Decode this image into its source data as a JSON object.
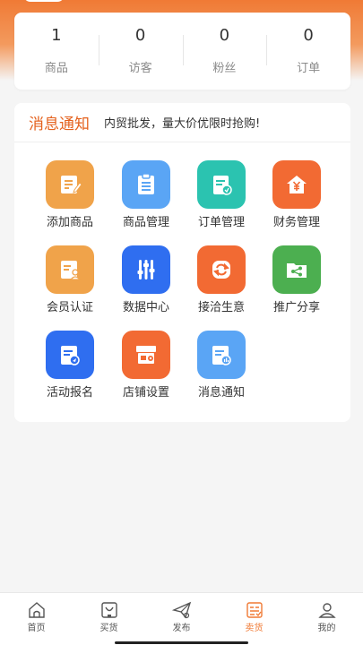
{
  "colors": {
    "accent": "#f07a35",
    "notice_title": "#e4611d",
    "icon_orange": "#f0a34a",
    "icon_blue": "#5aa5f5",
    "icon_teal": "#2bc3b0",
    "icon_red": "#f26a33",
    "icon_royal": "#2f6ef0",
    "icon_green": "#4caf50"
  },
  "stats": [
    {
      "value": "1",
      "label": "商品"
    },
    {
      "value": "0",
      "label": "访客"
    },
    {
      "value": "0",
      "label": "粉丝"
    },
    {
      "value": "0",
      "label": "订单"
    }
  ],
  "notice": {
    "title": "消息通知",
    "text": "内贸批发，量大价优限时抢购!"
  },
  "features": [
    {
      "label": "添加商品",
      "icon": "edit-doc-icon"
    },
    {
      "label": "商品管理",
      "icon": "clipboard-icon"
    },
    {
      "label": "订单管理",
      "icon": "order-doc-icon"
    },
    {
      "label": "财务管理",
      "icon": "yuan-house-icon"
    },
    {
      "label": "会员认证",
      "icon": "member-card-icon"
    },
    {
      "label": "数据中心",
      "icon": "sliders-icon"
    },
    {
      "label": "接洽生意",
      "icon": "exchange-icon"
    },
    {
      "label": "推广分享",
      "icon": "share-folder-icon"
    },
    {
      "label": "活动报名",
      "icon": "signup-doc-icon"
    },
    {
      "label": "店铺设置",
      "icon": "shop-settings-icon"
    },
    {
      "label": "消息通知",
      "icon": "message-doc-icon"
    }
  ],
  "nav": [
    {
      "label": "首页",
      "icon": "home-icon"
    },
    {
      "label": "买货",
      "icon": "buy-bag-icon"
    },
    {
      "label": "发布",
      "icon": "paper-plane-icon"
    },
    {
      "label": "卖货",
      "icon": "sell-list-icon",
      "active": true
    },
    {
      "label": "我的",
      "icon": "user-icon"
    }
  ]
}
